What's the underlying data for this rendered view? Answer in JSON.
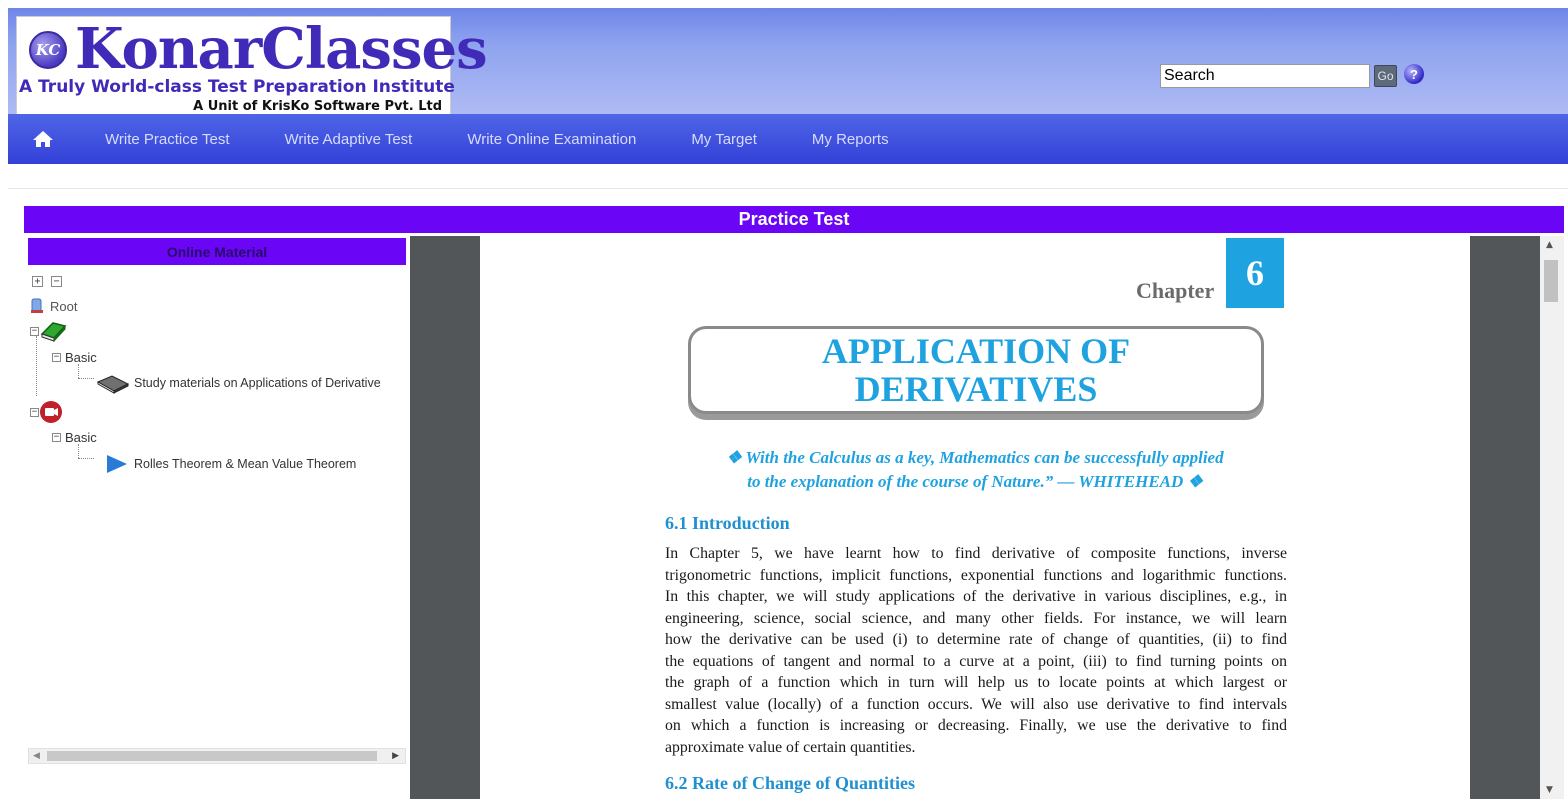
{
  "header": {
    "logo": {
      "badge": "KC",
      "title": "KonarClasses",
      "tagline": "A Truly World-class Test Preparation Institute",
      "unit": "A Unit of KrisKo Software Pvt. Ltd"
    },
    "search": {
      "value": "Search"
    },
    "go_label": "Go",
    "help_glyph": "?"
  },
  "nav": {
    "home_icon": "home-icon",
    "items": [
      "Write Practice Test",
      "Write Adaptive Test",
      "Write Online Examination",
      "My Target",
      "My Reports"
    ]
  },
  "practice_bar": {
    "title": "Practice Test"
  },
  "left_panel": {
    "header": "Online Material",
    "tree": {
      "expand_all": "+",
      "collapse_all": "−",
      "root_label": "Root",
      "group1": {
        "folder_label": "Basic",
        "item_label": "Study materials on Applications of Derivative"
      },
      "group2": {
        "folder_label": "Basic",
        "item_label": "Rolles Theorem & Mean Value Theorem"
      }
    }
  },
  "document": {
    "chapter_label": "Chapter",
    "chapter_number": "6",
    "title_line1": "APPLICATION OF",
    "title_line2": "DERIVATIVES",
    "quote_line1": "❖ With the Calculus as a key, Mathematics can be successfully applied",
    "quote_line2": "to the explanation of the course of Nature.” — WHITEHEAD ❖",
    "section1": "6.1 Introduction",
    "para_lines": [
      "In Chapter 5, we have learnt how to find derivative of composite functions, inverse",
      "trigonometric functions, implicit functions, exponential functions and logarithmic functions.",
      "In this chapter, we will study applications of the derivative in various disciplines, e.g., in",
      "engineering, science, social science, and many other fields. For instance, we will learn",
      "how the derivative can be used (i) to determine rate of change of quantities, (ii) to find",
      "the equations of tangent and normal to a curve at a point, (iii) to find turning points on",
      "the graph of a function which in turn will help us to locate points at which largest or",
      "smallest value (locally) of a function occurs. We will also use derivative to find intervals",
      "on which a function is increasing or decreasing. Finally, we use the derivative to find",
      "approximate value of certain quantities."
    ],
    "section2": "6.2 Rate of Change of Quantities"
  },
  "colors": {
    "accent_purple": "#6a06f5",
    "nav_blue": "#3341d8",
    "doc_cyan": "#1fa2e0"
  }
}
